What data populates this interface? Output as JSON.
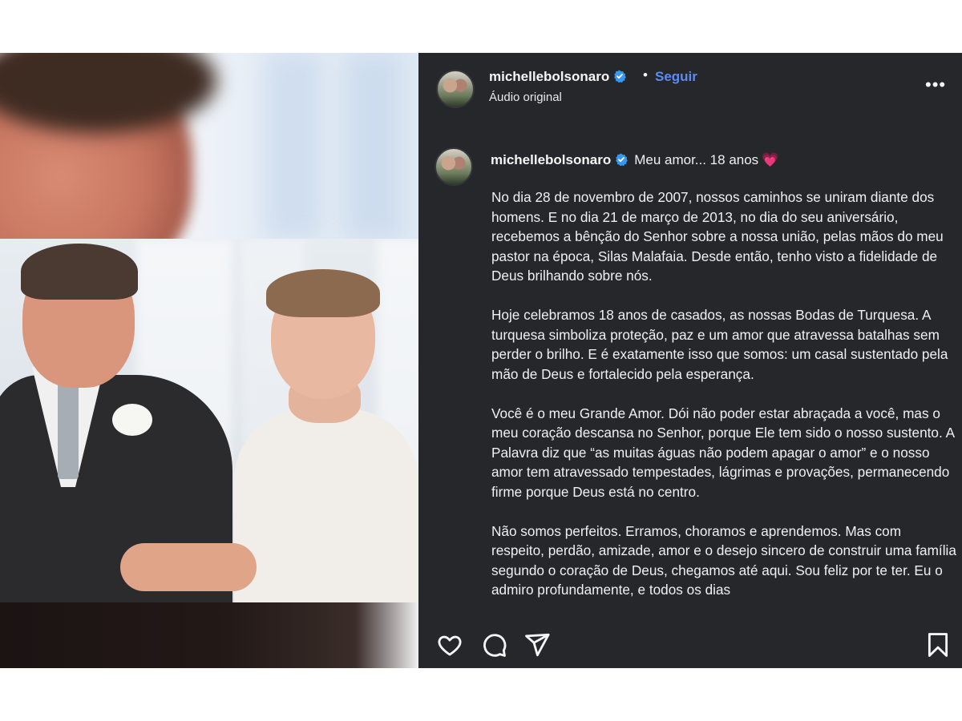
{
  "header": {
    "username": "michellebolsonaro",
    "separator": "•",
    "follow_label": "Seguir",
    "audio_label": "Áudio original",
    "more_label": "•••"
  },
  "caption": {
    "username": "michellebolsonaro",
    "title": "Meu amor... 18 anos",
    "title_emoji": "💗",
    "paragraphs": [
      "No dia 28 de novembro de 2007, nossos caminhos se uniram diante dos homens. E no dia 21 de março de 2013, no dia do seu aniversário, recebemos a bênção do Senhor sobre a nossa união, pelas mãos do meu pastor na época, Silas Malafaia. Desde então, tenho visto a fidelidade de Deus brilhando sobre nós.",
      "Hoje celebramos 18 anos de casados, as nossas Bodas de Turquesa. A turquesa simboliza proteção, paz e um amor que atravessa batalhas sem perder o brilho. E é exatamente isso que somos: um casal sustentado pela mão de Deus e fortalecido pela esperança.",
      "Você é o meu Grande Amor. Dói não poder estar abraçada a você, mas o meu coração descansa no Senhor, porque Ele tem sido o nosso sustento. A Palavra diz que “as muitas águas não podem apagar o amor” e o nosso amor tem atravessado tempestades, lágrimas e provações, permanecendo firme porque Deus está no centro.",
      "Não somos perfeitos. Erramos, choramos e aprendemos. Mas com respeito, perdão, amizade, amor e o desejo sincero de construir uma família segundo o coração de Deus, chegamos até aqui. Sou feliz por te ter. Eu o admiro profundamente, e todos os dias"
    ]
  },
  "actions": {
    "like": "heart-icon",
    "comment": "comment-icon",
    "share": "share-icon",
    "save": "bookmark-icon"
  },
  "colors": {
    "panel_bg": "#25272b",
    "follow_blue": "#5b8cf5",
    "verified_blue": "#3897f0"
  }
}
